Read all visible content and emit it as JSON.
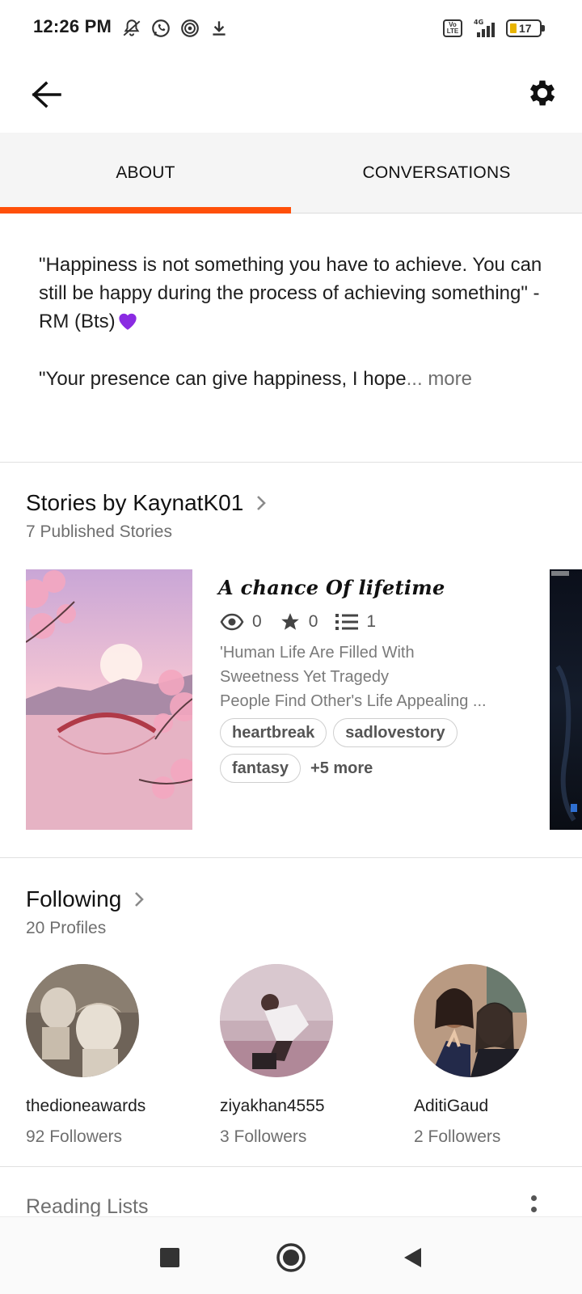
{
  "status_bar": {
    "time": "12:26 PM",
    "network": "4G",
    "battery": "17",
    "volte": "Vo LTE",
    "icons_left": [
      "mute-icon",
      "whatsapp-icon",
      "app-icon",
      "download-icon"
    ]
  },
  "toolbar": {
    "back_icon": "arrow-left-icon",
    "settings_icon": "gear-icon"
  },
  "tabs": [
    {
      "label": "ABOUT",
      "active": true
    },
    {
      "label": "CONVERSATIONS",
      "active": false
    }
  ],
  "about": {
    "para1": "\"Happiness is not something you have to achieve. You can still be happy during the process of achieving something\" - RM (Bts)",
    "para2": "\"Your presence can give happiness, I hope",
    "ellipsis": "...",
    "more": "more"
  },
  "stories": {
    "title": "Stories by KaynatK01",
    "subtitle": "7 Published Stories",
    "items": [
      {
        "title": "A chance Of lifetime",
        "reads": "0",
        "votes": "0",
        "parts": "1",
        "desc_lines": [
          "'Human Life Are Filled With",
          "Sweetness Yet Tragedy",
          "People Find Other's Life Appealing ..."
        ],
        "tags": [
          "heartbreak",
          "sadlovestory",
          "fantasy"
        ],
        "more_tags": "+5 more"
      }
    ]
  },
  "following": {
    "title": "Following",
    "subtitle": "20 Profiles",
    "profiles": [
      {
        "name": "thedioneawards",
        "followers": "92 Followers"
      },
      {
        "name": "ziyakhan4555",
        "followers": "3 Followers"
      },
      {
        "name": "AditiGaud",
        "followers": "2 Followers"
      }
    ]
  },
  "reading_lists": {
    "title": "Reading Lists"
  },
  "colors": {
    "accent": "#ff500a",
    "heart": "#8a2be2"
  }
}
